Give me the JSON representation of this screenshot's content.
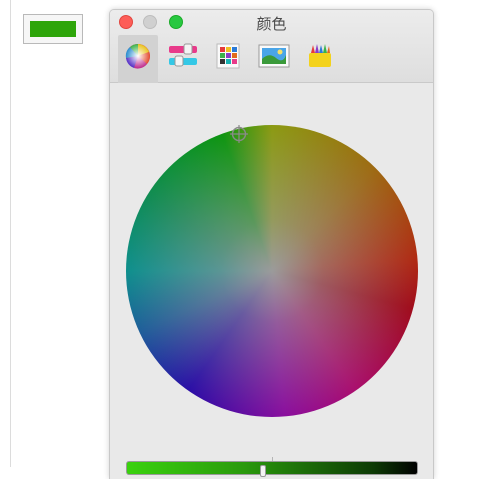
{
  "window": {
    "title": "颜色"
  },
  "color_well": {
    "color": "#2ea50a"
  },
  "toolbar": {
    "tabs": [
      {
        "icon": "color-wheel-icon",
        "active": true
      },
      {
        "icon": "color-sliders-icon",
        "active": false
      },
      {
        "icon": "color-palettes-icon",
        "active": false
      },
      {
        "icon": "image-palettes-icon",
        "active": false
      },
      {
        "icon": "pencils-icon",
        "active": false
      }
    ]
  },
  "colors": {
    "close": "#fd5d57",
    "minimize": "#d0d0d0",
    "maximize": "#28c840",
    "selected": "#2ea50a"
  },
  "brightness_slider": {
    "value_fraction": 0.47
  }
}
